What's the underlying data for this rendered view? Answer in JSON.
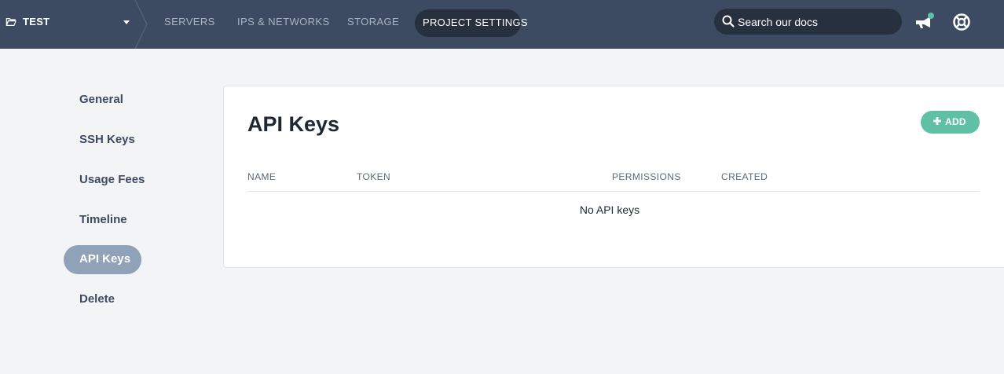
{
  "project": {
    "name": "TEST"
  },
  "nav": {
    "items": [
      {
        "label": "SERVERS"
      },
      {
        "label": "IPS & NETWORKS"
      },
      {
        "label": "STORAGE"
      },
      {
        "label": "PROJECT SETTINGS",
        "active": true
      }
    ]
  },
  "search": {
    "placeholder": "Search our docs"
  },
  "icons": {
    "folder": "folder-icon",
    "caret": "caret-down-icon",
    "search": "search-icon",
    "announcement": "megaphone-icon",
    "help": "lifebuoy-icon",
    "add": "plus-icon"
  },
  "sidebar": {
    "items": [
      {
        "label": "General"
      },
      {
        "label": "SSH Keys"
      },
      {
        "label": "Usage Fees"
      },
      {
        "label": "Timeline"
      },
      {
        "label": "API Keys",
        "active": true
      },
      {
        "label": "Delete"
      }
    ]
  },
  "main": {
    "title": "API Keys",
    "add_label": "ADD",
    "columns": [
      "NAME",
      "TOKEN",
      "PERMISSIONS",
      "CREATED"
    ],
    "empty_message": "No API keys"
  },
  "colors": {
    "topbar": "#3d4b62",
    "active_pill": "#27303f",
    "sidebar_active": "#8fa2b8",
    "accent_green": "#5fc0a5",
    "notification_dot": "#5fc0a5"
  }
}
